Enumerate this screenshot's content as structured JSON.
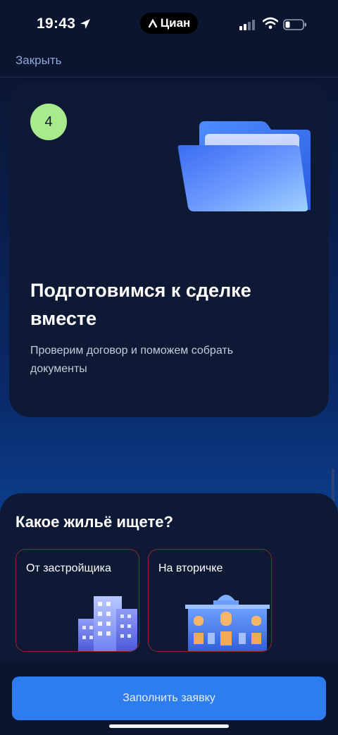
{
  "status_bar": {
    "time": "19:43",
    "app_name": "Циан"
  },
  "nav": {
    "close_label": "Закрыть"
  },
  "step_card": {
    "number": "4",
    "title": "Подготовимся к сделке вместе",
    "description": "Проверим договор и поможем собрать документы"
  },
  "housing": {
    "title": "Какое жильё ищете?",
    "options": [
      {
        "label": "От застройщика"
      },
      {
        "label": "На вторичке"
      }
    ]
  },
  "footer": {
    "submit_label": "Заполнить заявку"
  },
  "colors": {
    "accent": "#2d7df0",
    "badge": "#a9ea8c",
    "card_border": "#8a2530",
    "card_bg": "#0e1a35"
  }
}
